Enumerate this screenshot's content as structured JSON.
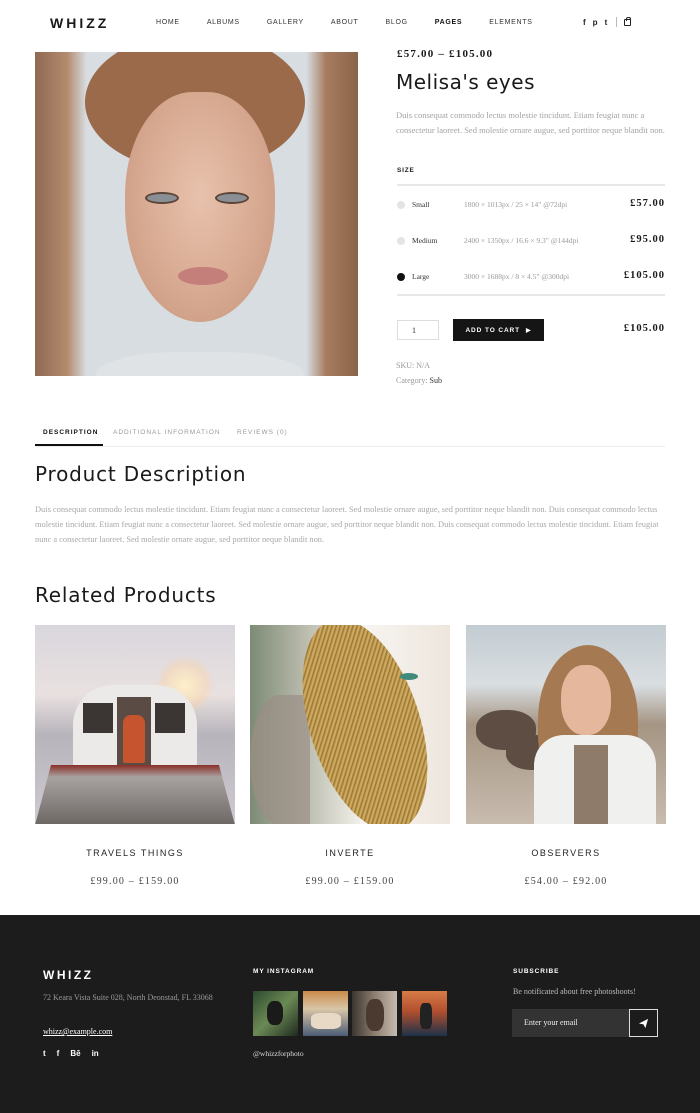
{
  "header": {
    "logo": "WHIZZ",
    "nav": [
      "HOME",
      "ALBUMS",
      "GALLERY",
      "ABOUT",
      "BLOG",
      "PAGES",
      "ELEMENTS"
    ],
    "active_nav": "PAGES",
    "social": [
      "f",
      "p",
      "t"
    ],
    "social_icons": [
      "facebook-icon",
      "pinterest-icon",
      "twitter-icon"
    ],
    "cart_icon": "shopping-bag-icon"
  },
  "product": {
    "price_range": "£57.00 – £105.00",
    "title": "Melisa's eyes",
    "description": "Duis consequat commodo lectus molestie tincidunt. Etiam feugiat nunc a consectetur laoreet. Sed molestie ornare augue, sed porttitor neque blandit non.",
    "size_label": "SIZE",
    "sizes": [
      {
        "name": "Small",
        "dims": "1800 × 1013px / 25 × 14\" @72dpi",
        "price": "£57.00",
        "selected": false
      },
      {
        "name": "Medium",
        "dims": "2400 × 1350px / 16.6 × 9.3\" @144dpi",
        "price": "£95.00",
        "selected": false
      },
      {
        "name": "Large",
        "dims": "3000 × 1688px / 8 × 4.5\" @300dpi",
        "price": "£105.00",
        "selected": true
      }
    ],
    "quantity": "1",
    "add_to_cart": "ADD TO CART",
    "total": "£105.00",
    "sku_label": "SKU:",
    "sku_value": "N/A",
    "category_label": "Category:",
    "category_value": "Sub"
  },
  "tabs": [
    {
      "label": "DESCRIPTION",
      "active": true
    },
    {
      "label": "ADDITIONAL INFORMATION",
      "active": false
    },
    {
      "label": "REVIEWS (0)",
      "active": false
    }
  ],
  "description_section": {
    "title": "Product Description",
    "text": "Duis consequat commodo lectus molestie tincidunt. Etiam feugiat nunc a consectetur laoreet. Sed molestie ornare augue, sed porttitor neque blandit non. Duis consequat commodo lectus molestie tincidunt. Etiam feugiat nunc a consectetur laoreet. Sed molestie ornare augue, sed porttitor neque blandit non. Duis consequat commodo lectus molestie tincidunt. Etiam feugiat nunc a consectetur laoreet. Sed molestie ornare augue, sed porttitor neque blandit non."
  },
  "related": {
    "title": "Related Products",
    "items": [
      {
        "name": "TRAVELS THINGS",
        "price": "£99.00 – £159.00"
      },
      {
        "name": "INVERTE",
        "price": "£99.00 – £159.00"
      },
      {
        "name": "OBSERVERS",
        "price": "£54.00 – £92.00"
      }
    ]
  },
  "footer": {
    "logo": "WHIZZ",
    "address": "72 Keara Vista Suite 028, North Deonstad, FL 33068",
    "email": "whizz@example.com",
    "social": [
      "t",
      "f",
      "Bē",
      "in"
    ],
    "social_icons": [
      "twitter-icon",
      "facebook-icon",
      "behance-icon",
      "linkedin-icon"
    ],
    "instagram_title": "MY INSTAGRAM",
    "instagram_handle": "@whizzforphoto",
    "subscribe_title": "SUBSCRIBE",
    "subscribe_text": "Be notificated about free photoshoots!",
    "email_placeholder": "Enter your email"
  },
  "colors": {
    "accent": "#151515",
    "footer_bg": "#1c1c1c",
    "muted_text": "#a3a3a3"
  }
}
